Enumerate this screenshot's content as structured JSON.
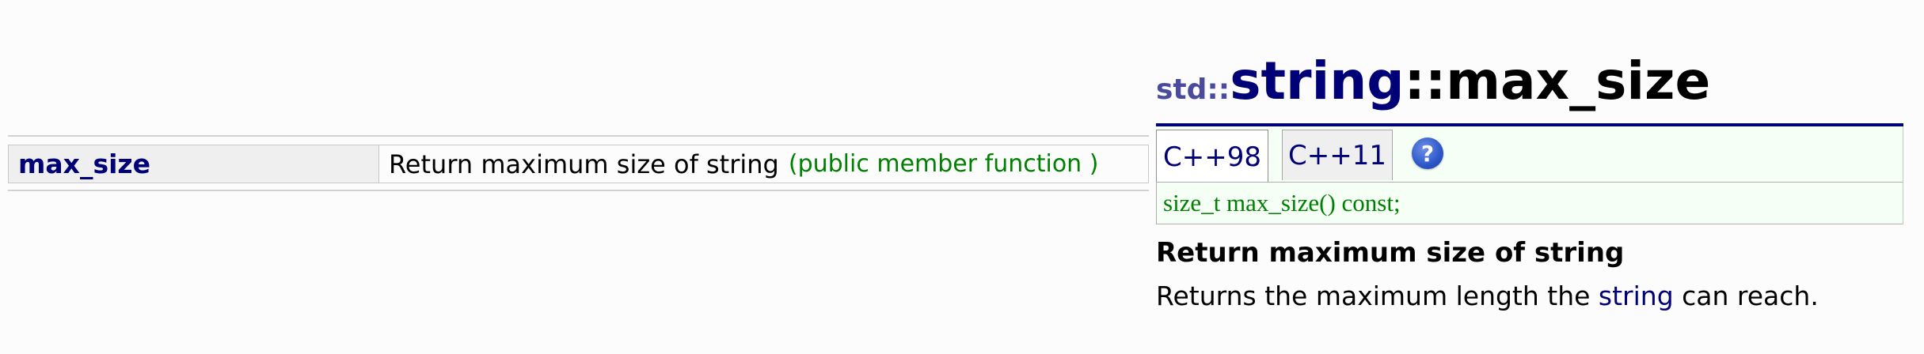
{
  "member_list": {
    "rows": [
      {
        "name": "max_size",
        "description": "Return maximum size of string",
        "kind": "(public member function )"
      }
    ]
  },
  "detail": {
    "title": {
      "namespace": "std::",
      "class_name": "string",
      "member": "::max_size"
    },
    "tabs": [
      {
        "label": "C++98",
        "active": true
      },
      {
        "label": "C++11",
        "active": false
      }
    ],
    "help_icon": {
      "name": "help-icon",
      "glyph": "?"
    },
    "declaration": "size_t max_size() const;",
    "heading": "Return maximum size of string",
    "text_before": "Returns the maximum length the ",
    "text_link": "string",
    "text_after": " can reach."
  },
  "colors": {
    "link": "#000077",
    "code_green": "#008000",
    "rule_blue": "#000077"
  }
}
